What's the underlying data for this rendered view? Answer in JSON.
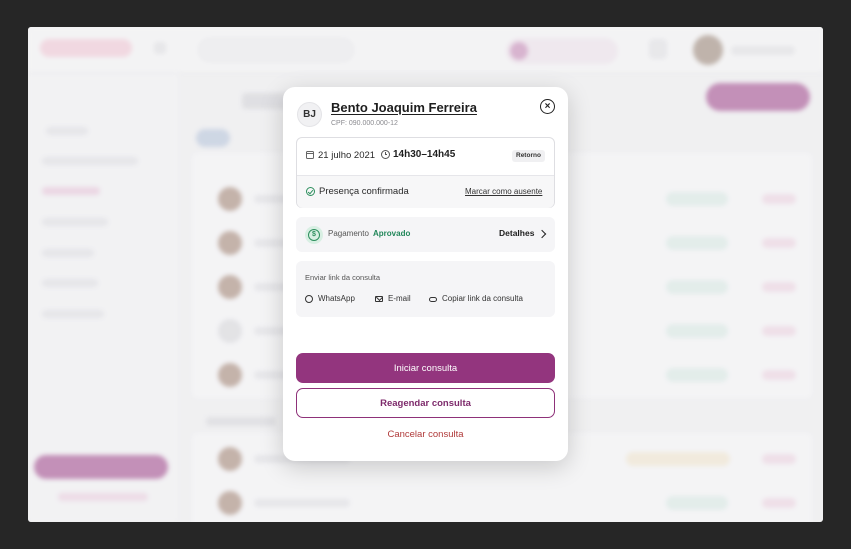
{
  "modal": {
    "initials": "BJ",
    "patient_name": "Bento Joaquim Ferreira",
    "cpf": "CPF: 090.000.000-12",
    "close_icon": "×",
    "appointment": {
      "date": "21 julho 2021",
      "time": "14h30–14h45",
      "type_badge": "Retorno",
      "presence": "Presença confirmada",
      "mark_absent": "Marcar como ausente"
    },
    "payment": {
      "label": "Pagamento",
      "status": "Aprovado",
      "details": "Detalhes"
    },
    "share": {
      "title": "Enviar link da consulta",
      "options": [
        "WhatsApp",
        "E-mail",
        "Copiar link da consulta"
      ]
    },
    "actions": {
      "start": "Iniciar consulta",
      "reschedule": "Reagendar consulta",
      "cancel": "Cancelar consulta"
    }
  },
  "colors": {
    "primary": "#93357e",
    "success": "#22875a",
    "danger": "#b03a3a",
    "backdrop": "#262626"
  },
  "icons": {
    "calendar": "calendar-icon",
    "clock": "clock-icon",
    "check": "check-circle-icon",
    "payment": "dollar-icon",
    "chevron": "chevron-right-icon",
    "whatsapp": "whatsapp-icon",
    "email": "mail-icon",
    "link": "link-icon",
    "close": "close-icon"
  }
}
